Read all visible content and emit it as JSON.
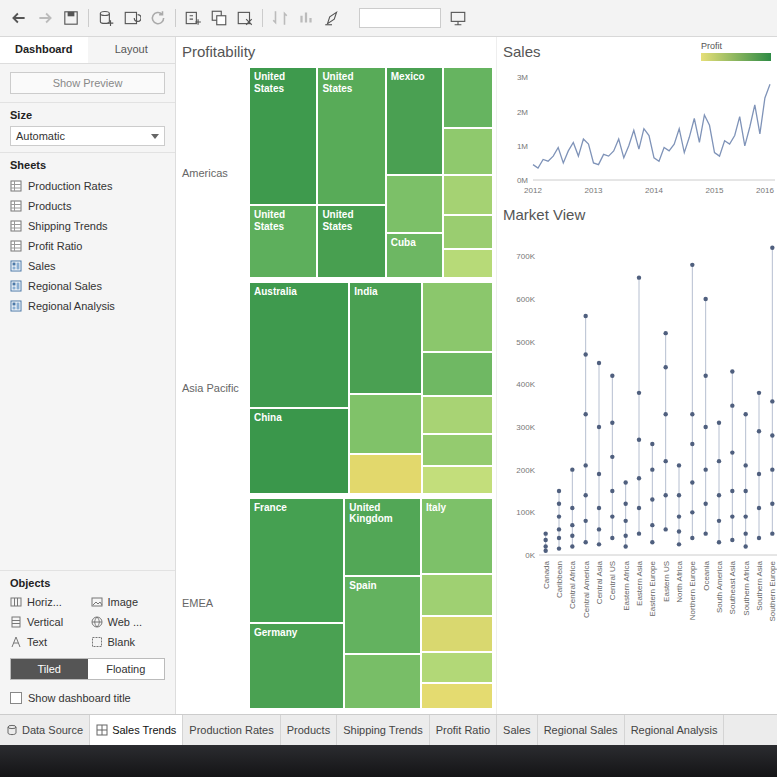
{
  "side_panel": {
    "tabs": [
      {
        "label": "Dashboard",
        "selected": true
      },
      {
        "label": "Layout",
        "selected": false
      }
    ],
    "preview_button": "Show Preview",
    "size": {
      "label": "Size",
      "value": "Automatic"
    },
    "sheets": {
      "title": "Sheets",
      "items": [
        {
          "label": "Production Rates",
          "kind": "worksheet"
        },
        {
          "label": "Products",
          "kind": "worksheet"
        },
        {
          "label": "Shipping Trends",
          "kind": "worksheet"
        },
        {
          "label": "Profit Ratio",
          "kind": "worksheet"
        },
        {
          "label": "Sales",
          "kind": "dashboard"
        },
        {
          "label": "Regional Sales",
          "kind": "dashboard"
        },
        {
          "label": "Regional Analysis",
          "kind": "dashboard"
        }
      ]
    },
    "objects": {
      "title": "Objects",
      "items": [
        {
          "label": "Horiz...",
          "kind": "horizontal"
        },
        {
          "label": "Image",
          "kind": "image"
        },
        {
          "label": "Vertical",
          "kind": "vertical"
        },
        {
          "label": "Web ...",
          "kind": "web"
        },
        {
          "label": "Text",
          "kind": "text"
        },
        {
          "label": "Blank",
          "kind": "blank"
        }
      ]
    },
    "layout_mode": [
      {
        "label": "Tiled",
        "selected": true
      },
      {
        "label": "Floating",
        "selected": false
      }
    ],
    "show_title": {
      "label": "Show dashboard title",
      "checked": false
    }
  },
  "profitability": {
    "title": "Profitability",
    "regions": [
      {
        "label": "Americas",
        "columns": [
          {
            "tiles": [
              {
                "label": "United States",
                "value": 6,
                "color": "#3e9a4d"
              },
              {
                "label": "United States",
                "value": 3,
                "color": "#5daf5c"
              }
            ]
          },
          {
            "tiles": [
              {
                "label": "United States",
                "value": 6,
                "color": "#58ab58"
              },
              {
                "label": "United States",
                "value": 3,
                "color": "#489f50"
              }
            ]
          },
          {
            "tiles": [
              {
                "label": "Mexico",
                "value": 4,
                "color": "#4aa052"
              },
              {
                "value": 2,
                "color": "#7cc068"
              },
              {
                "label": "Cuba",
                "value": 1.5,
                "color": "#6db763"
              }
            ]
          },
          {
            "tiles": [
              {
                "value": 2,
                "color": "#66b460"
              },
              {
                "value": 1.5,
                "color": "#8fc96d"
              },
              {
                "value": 1.2,
                "color": "#a5d273"
              },
              {
                "value": 1,
                "color": "#9acd70"
              },
              {
                "value": 0.8,
                "color": "#b7da78"
              }
            ]
          }
        ]
      },
      {
        "label": "Asia Pacific",
        "columns": [
          {
            "tiles": [
              {
                "label": "Australia",
                "value": 6,
                "color": "#3f9a4e"
              },
              {
                "label": "China",
                "value": 4,
                "color": "#3a974b"
              }
            ]
          },
          {
            "tiles": [
              {
                "label": "India",
                "value": 4,
                "color": "#4aa052"
              },
              {
                "value": 2,
                "color": "#80c269"
              },
              {
                "value": 1.2,
                "color": "#e2d86c"
              }
            ]
          },
          {
            "tiles": [
              {
                "value": 2.5,
                "color": "#8bc76c"
              },
              {
                "value": 1.5,
                "color": "#6fb863"
              },
              {
                "value": 1.2,
                "color": "#a8d374"
              },
              {
                "value": 1,
                "color": "#94cb6f"
              },
              {
                "value": 0.8,
                "color": "#c3de7b"
              }
            ]
          }
        ]
      },
      {
        "label": "EMEA",
        "columns": [
          {
            "tiles": [
              {
                "label": "France",
                "value": 6,
                "color": "#45a051"
              },
              {
                "label": "Germany",
                "value": 4,
                "color": "#4aa152"
              }
            ]
          },
          {
            "tiles": [
              {
                "label": "United Kingdom",
                "value": 3,
                "color": "#52a756"
              },
              {
                "label": "Spain",
                "value": 3,
                "color": "#63b25f"
              },
              {
                "value": 2,
                "color": "#78be67"
              }
            ]
          },
          {
            "tiles": [
              {
                "label": "Italy",
                "value": 3,
                "color": "#7dc169"
              },
              {
                "value": 1.5,
                "color": "#9fd072"
              },
              {
                "value": 1.2,
                "color": "#d9d86f"
              },
              {
                "value": 1,
                "color": "#b2d877"
              },
              {
                "value": 0.8,
                "color": "#e4db70"
              }
            ]
          }
        ]
      }
    ]
  },
  "sales_chart": {
    "title": "Sales",
    "y_range": [
      0,
      3.1
    ],
    "y_ticks": [
      {
        "label": "3M",
        "value": 3
      },
      {
        "label": "2M",
        "value": 2
      },
      {
        "label": "1M",
        "value": 1
      },
      {
        "label": "0M",
        "value": 0
      }
    ],
    "x_ticks": [
      {
        "label": "2012",
        "index": 0
      },
      {
        "label": "2013",
        "index": 12
      },
      {
        "label": "2014",
        "index": 24
      },
      {
        "label": "2015",
        "index": 36
      },
      {
        "label": "2016",
        "index": 48
      }
    ],
    "values": [
      0.45,
      0.35,
      0.6,
      0.55,
      0.7,
      0.95,
      0.5,
      0.85,
      1.1,
      0.7,
      1.2,
      1.05,
      0.5,
      0.45,
      0.75,
      0.7,
      0.85,
      1.2,
      0.65,
      1.0,
      1.45,
      0.9,
      1.5,
      1.3,
      0.65,
      0.55,
      0.95,
      0.85,
      1.05,
      1.5,
      0.8,
      1.25,
      1.8,
      1.1,
      1.9,
      1.6,
      0.8,
      0.7,
      1.15,
      1.05,
      1.3,
      1.85,
      1.0,
      1.55,
      2.2,
      1.35,
      2.4,
      2.8
    ]
  },
  "legend": {
    "title": "Profit"
  },
  "market_view": {
    "title": "Market View",
    "y_range": [
      0,
      750
    ],
    "y_ticks": [
      {
        "label": "700K",
        "value": 700
      },
      {
        "label": "600K",
        "value": 600
      },
      {
        "label": "500K",
        "value": 500
      },
      {
        "label": "400K",
        "value": 400
      },
      {
        "label": "300K",
        "value": 300
      },
      {
        "label": "200K",
        "value": 200
      },
      {
        "label": "100K",
        "value": 100
      },
      {
        "label": "0K",
        "value": 0
      }
    ],
    "categories": [
      {
        "label": "Canada",
        "values": [
          10,
          20,
          35,
          50
        ]
      },
      {
        "label": "Caribbean",
        "values": [
          15,
          40,
          60,
          90,
          120,
          150
        ]
      },
      {
        "label": "Central Africa",
        "values": [
          20,
          45,
          70,
          110,
          200
        ]
      },
      {
        "label": "Central America",
        "values": [
          30,
          80,
          140,
          210,
          330,
          470,
          560
        ]
      },
      {
        "label": "Central Asia",
        "values": [
          25,
          60,
          110,
          190,
          300,
          450
        ]
      },
      {
        "label": "Central US",
        "values": [
          40,
          90,
          150,
          230,
          310,
          420
        ]
      },
      {
        "label": "Eastern Africa",
        "values": [
          20,
          45,
          80,
          120,
          170
        ]
      },
      {
        "label": "Eastern Asia",
        "values": [
          50,
          110,
          180,
          270,
          380,
          650
        ]
      },
      {
        "label": "Eastern Europe",
        "values": [
          30,
          70,
          130,
          200,
          260
        ]
      },
      {
        "label": "Eastern US",
        "values": [
          60,
          140,
          220,
          330,
          440,
          520
        ]
      },
      {
        "label": "North Africa",
        "values": [
          25,
          55,
          90,
          140,
          210
        ]
      },
      {
        "label": "Northern Europe",
        "values": [
          40,
          100,
          170,
          260,
          330,
          680
        ]
      },
      {
        "label": "Oceania",
        "values": [
          50,
          120,
          200,
          300,
          420,
          600
        ]
      },
      {
        "label": "South America",
        "values": [
          30,
          80,
          140,
          220,
          310
        ]
      },
      {
        "label": "Southeast Asia",
        "values": [
          35,
          90,
          150,
          240,
          350,
          430
        ]
      },
      {
        "label": "Southern Africa",
        "values": [
          20,
          50,
          90,
          150,
          210,
          330
        ]
      },
      {
        "label": "Southern Asia",
        "values": [
          40,
          110,
          190,
          290,
          380
        ]
      },
      {
        "label": "Southern Europe",
        "values": [
          50,
          120,
          200,
          280,
          360,
          720
        ]
      }
    ]
  },
  "sheet_tabs": [
    {
      "label": "Data Source",
      "kind": "source",
      "selected": false
    },
    {
      "label": "Sales Trends",
      "kind": "dashboard",
      "selected": true
    },
    {
      "label": "Production Rates",
      "kind": "sheet",
      "selected": false
    },
    {
      "label": "Products",
      "kind": "sheet",
      "selected": false
    },
    {
      "label": "Shipping Trends",
      "kind": "sheet",
      "selected": false
    },
    {
      "label": "Profit Ratio",
      "kind": "sheet",
      "selected": false
    },
    {
      "label": "Sales",
      "kind": "sheet",
      "selected": false
    },
    {
      "label": "Regional Sales",
      "kind": "sheet",
      "selected": false
    },
    {
      "label": "Regional Analysis",
      "kind": "sheet",
      "selected": false
    }
  ]
}
